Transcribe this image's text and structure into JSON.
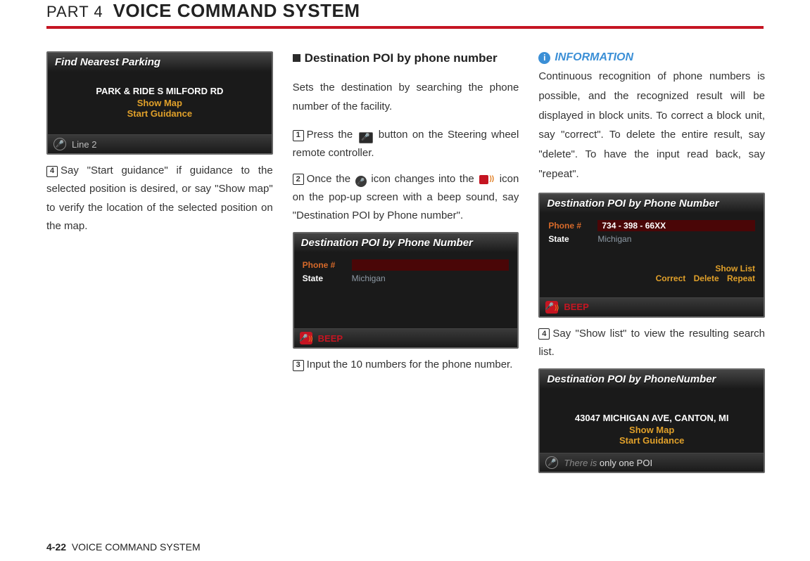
{
  "header": {
    "part": "PART 4",
    "title": "VOICE COMMAND SYSTEM"
  },
  "footer": {
    "page": "4-22",
    "section": "VOICE COMMAND SYSTEM"
  },
  "col1": {
    "shot": {
      "title": "Find Nearest Parking",
      "poi": "PARK & RIDE S MILFORD RD",
      "showMap": "Show Map",
      "startGuidance": "Start Guidance",
      "footer": "Line 2"
    },
    "step4": "Say \"Start guidance\" if guidance to the selected position is desired, or say \"Show map\" to verify the location of the selected position on the map."
  },
  "col2": {
    "heading": "Destination POI by phone number",
    "intro": "Sets the destination by searching the phone number of the facility.",
    "step1a": "Press the ",
    "step1b": " button on the Steering wheel remote controller.",
    "step2a": "Once the ",
    "step2b": " icon changes into the ",
    "step2c": " icon on the pop-up screen with a beep sound, say \"Destination POI by Phone number\".",
    "shot": {
      "title": "Destination POI by Phone Number",
      "phoneLabel": "Phone #",
      "stateLabel": "State",
      "stateVal": "Michigan",
      "beep": "BEEP"
    },
    "step3": "Input the 10 numbers for the phone number."
  },
  "col3": {
    "infoTitle": "INFORMATION",
    "infoBody": "Continuous recognition of phone numbers is possible, and the recognized result will be displayed in block units. To correct a block unit, say \"correct\". To delete the entire result, say \"delete\". To have the input read back, say \"repeat\".",
    "shot1": {
      "title": "Destination POI by Phone Number",
      "phoneLabel": "Phone #",
      "phoneVal": "734 - 398 - 66XX",
      "stateLabel": "State",
      "stateVal": "Michigan",
      "showList": "Show List",
      "correct": "Correct",
      "delete": "Delete",
      "repeat": "Repeat",
      "beep": "BEEP"
    },
    "step4": "Say \"Show list\" to view the resulting search list.",
    "shot2": {
      "title": "Destination POI by PhoneNumber",
      "addr": "43047 MICHIGAN AVE, CANTON, MI",
      "showMap": "Show Map",
      "startGuidance": "Start Guidance",
      "there": "There is",
      "one": " only one POI"
    }
  }
}
